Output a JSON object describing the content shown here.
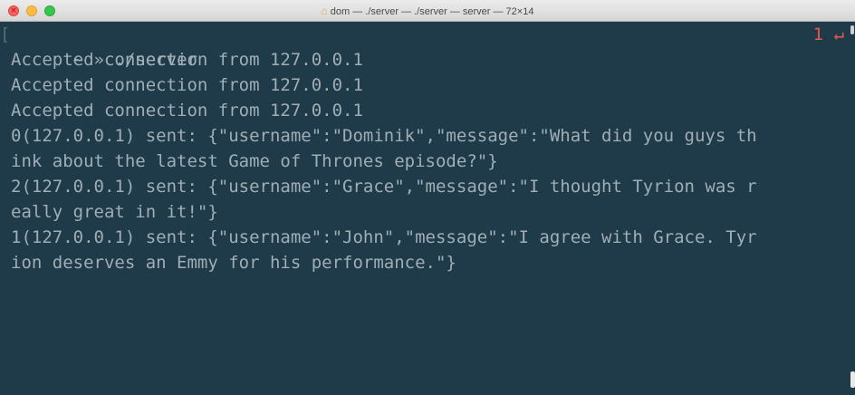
{
  "window": {
    "title": "dom — ./server — ./server — server — 72×14",
    "title_icon": "folder-icon",
    "colors": {
      "background": "#1f3a49",
      "text": "#a0aeb5",
      "status": "#e05a4a",
      "close": "#fc605b",
      "minimize": "#fdbc40",
      "maximize": "#34c84a"
    }
  },
  "prompt": {
    "tilde": "~",
    "arrow": "»",
    "command": "./server",
    "exit_status": "1",
    "status_icon": "return-arrow-icon",
    "status_glyph": "↵"
  },
  "output": {
    "lines": [
      "Accepted connection from 127.0.0.1",
      "Accepted connection from 127.0.0.1",
      "Accepted connection from 127.0.0.1",
      "0(127.0.0.1) sent: {\"username\":\"Dominik\",\"message\":\"What did you guys th",
      "ink about the latest Game of Thrones episode?\"}",
      "2(127.0.0.1) sent: {\"username\":\"Grace\",\"message\":\"I thought Tyrion was r",
      "eally great in it!\"}",
      "1(127.0.0.1) sent: {\"username\":\"John\",\"message\":\"I agree with Grace. Tyr",
      "ion deserves an Emmy for his performance.\"}"
    ]
  }
}
